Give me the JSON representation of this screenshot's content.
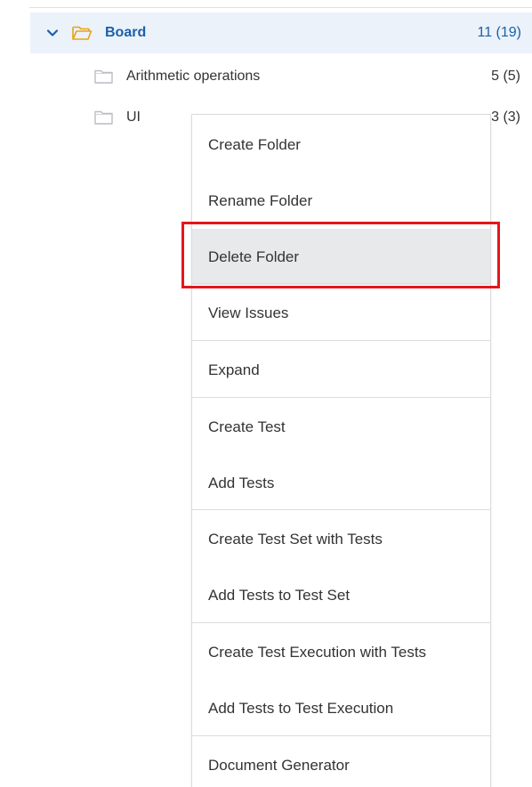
{
  "tree": {
    "root": {
      "label": "Board",
      "count": "11 (19)",
      "expanded": true,
      "icon": "folder-open-icon",
      "color": "#1d5fa8"
    },
    "children": [
      {
        "label": "Arithmetic operations",
        "count": "5 (5)",
        "icon": "folder-icon"
      },
      {
        "label": "UI",
        "count": "3 (3)",
        "icon": "folder-icon"
      }
    ]
  },
  "context_menu": {
    "items": [
      {
        "label": "Create Folder"
      },
      {
        "label": "Rename Folder"
      },
      {
        "label": "Delete Folder",
        "state": "hovered",
        "highlighted": true
      },
      {
        "label": "View Issues"
      },
      {
        "label": "Expand"
      },
      {
        "label": "Create Test"
      },
      {
        "label": "Add Tests"
      },
      {
        "label": "Create Test Set with Tests"
      },
      {
        "label": "Add Tests to Test Set"
      },
      {
        "label": "Create Test Execution with Tests"
      },
      {
        "label": "Add Tests to Test Execution"
      },
      {
        "label": "Document Generator"
      }
    ]
  },
  "annotation": {
    "highlight_color": "#e5161b"
  }
}
